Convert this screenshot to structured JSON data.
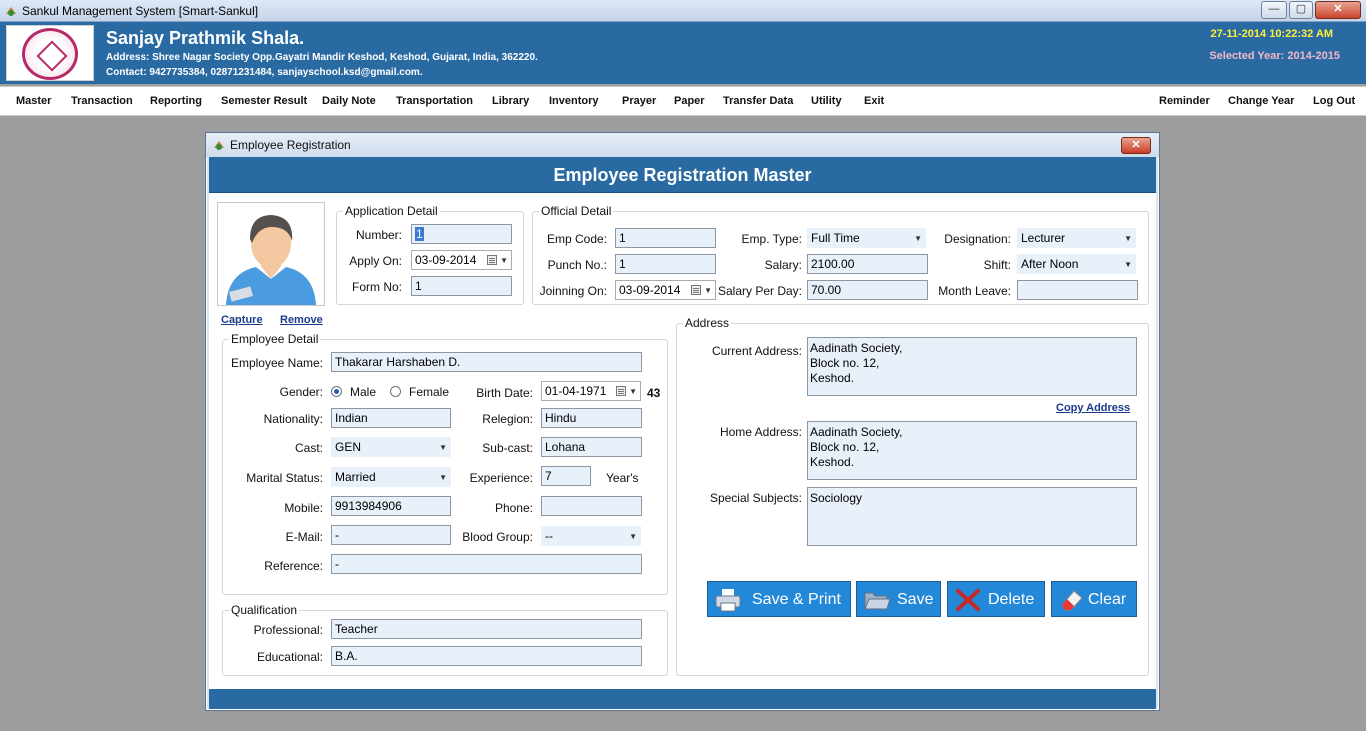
{
  "window": {
    "title": "Sankul Management System [Smart-Sankul]",
    "controls": [
      "—",
      "▢",
      "✕"
    ]
  },
  "header": {
    "school_name": "Sanjay Prathmik Shala.",
    "address": "Address: Shree Nagar Society  Opp.Gayatri Mandir Keshod, Keshod, Gujarat, India, 362220.",
    "contact": "Contact: 9427735384, 02871231484, sanjayschool.ksd@gmail.com.",
    "datetime": "27-11-2014 10:22:32 AM",
    "selected_year": "Selected Year: 2014-2015",
    "colors": {
      "header_bg": "#2a6aa2",
      "date": "#ffef3a",
      "year": "#f3b8c8"
    }
  },
  "menu": {
    "left": [
      "Master",
      "Transaction",
      "Reporting",
      "Semester Result",
      "Daily Note",
      "Transportation",
      "Library",
      "Inventory",
      "Prayer",
      "Paper",
      "Transfer Data",
      "Utility",
      "Exit"
    ],
    "right": [
      "Reminder",
      "Change Year",
      "Log Out"
    ]
  },
  "dialog": {
    "title": "Employee Registration",
    "close": "✕",
    "banner": "Employee Registration Master",
    "photo_links": {
      "capture": "Capture",
      "remove": "Remove"
    },
    "application": {
      "legend": "Application Detail",
      "number_label": "Number:",
      "number_value": "1",
      "apply_on_label": "Apply On:",
      "apply_on_value": "03-09-2014",
      "form_no_label": "Form No:",
      "form_no_value": "1"
    },
    "official": {
      "legend": "Official Detail",
      "emp_code_label": "Emp Code:",
      "emp_code_value": "1",
      "punch_label": "Punch No.:",
      "punch_value": "1",
      "joining_label": "Joinning On:",
      "joining_value": "03-09-2014",
      "emp_type_label": "Emp. Type:",
      "emp_type_value": "Full Time",
      "salary_label": "Salary:",
      "salary_value": "2100.00",
      "salary_day_label": "Salary Per Day:",
      "salary_day_value": "70.00",
      "designation_label": "Designation:",
      "designation_value": "Lecturer",
      "shift_label": "Shift:",
      "shift_value": "After Noon",
      "month_leave_label": "Month Leave:",
      "month_leave_value": ""
    },
    "employee": {
      "legend": "Employee Detail",
      "name_label": "Employee Name:",
      "name_value": "Thakarar Harshaben  D.",
      "gender_label": "Gender:",
      "gender_male": "Male",
      "gender_female": "Female",
      "gender_selected": "Male",
      "birth_label": "Birth Date:",
      "birth_value": "01-04-1971",
      "age": "43",
      "nationality_label": "Nationality:",
      "nationality_value": "Indian",
      "religion_label": "Relegion:",
      "religion_value": "Hindu",
      "cast_label": "Cast:",
      "cast_value": "GEN",
      "subcast_label": "Sub-cast:",
      "subcast_value": "Lohana",
      "marital_label": "Marital Status:",
      "marital_value": "Married",
      "experience_label": "Experience:",
      "experience_value": "7",
      "experience_unit": "Year's",
      "mobile_label": "Mobile:",
      "mobile_value": "9913984906",
      "phone_label": "Phone:",
      "phone_value": "",
      "email_label": "E-Mail:",
      "email_value": "-",
      "blood_label": "Blood Group:",
      "blood_value": "--",
      "reference_label": "Reference:",
      "reference_value": "-"
    },
    "qualification": {
      "legend": "Qualification",
      "professional_label": "Professional:",
      "professional_value": "Teacher",
      "educational_label": "Educational:",
      "educational_value": "B.A."
    },
    "address": {
      "legend": "Address",
      "current_label": "Current Address:",
      "current_value": "Aadinath Society,\nBlock no. 12,\nKeshod.",
      "copy_link": "Copy Address",
      "home_label": "Home Address:",
      "home_value": "Aadinath Society,\nBlock no. 12,\nKeshod.",
      "special_label": "Special Subjects:",
      "special_value": "Sociology"
    },
    "buttons": {
      "save_print": "Save & Print",
      "save": "Save",
      "delete": "Delete",
      "clear": "Clear",
      "color": "#2488d8"
    }
  }
}
